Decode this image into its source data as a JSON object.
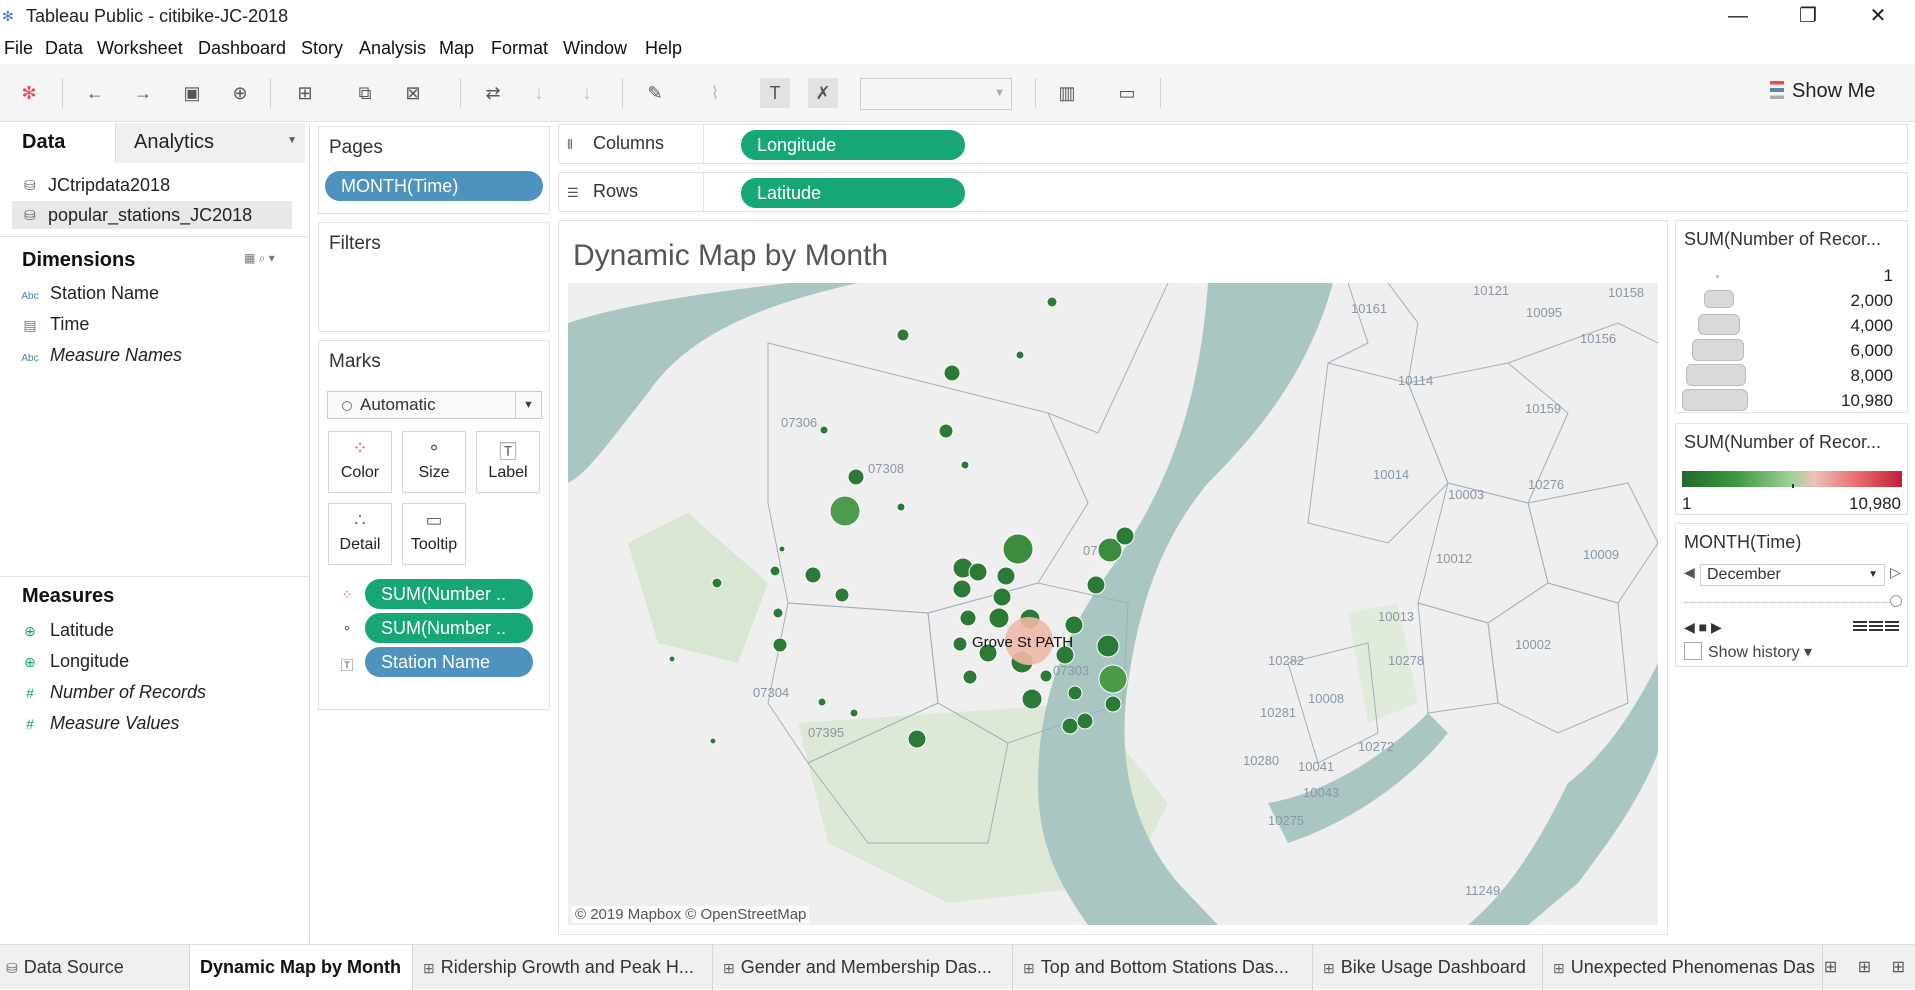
{
  "window": {
    "title": "Tableau Public - citibike-JC-2018",
    "minimize": "—",
    "restore": "❐",
    "close": "✕"
  },
  "menu": [
    "File",
    "Data",
    "Worksheet",
    "Dashboard",
    "Story",
    "Analysis",
    "Map",
    "Format",
    "Window",
    "Help"
  ],
  "toolbar": {
    "show_me": "Show Me"
  },
  "data_pane": {
    "tab_data": "Data",
    "tab_analytics": "Analytics",
    "datasources": [
      "JCtripdata2018",
      "popular_stations_JC2018"
    ],
    "dimensions_title": "Dimensions",
    "dimensions": [
      {
        "type": "Abc",
        "name": "Station Name"
      },
      {
        "type": "date",
        "name": "Time"
      },
      {
        "type": "Abc",
        "name": "Measure Names"
      }
    ],
    "measures_title": "Measures",
    "measures": [
      {
        "type": "geo",
        "name": "Latitude"
      },
      {
        "type": "geo",
        "name": "Longitude"
      },
      {
        "type": "num",
        "name": "Number of Records"
      },
      {
        "type": "num",
        "name": "Measure Values"
      }
    ]
  },
  "pages": {
    "title": "Pages",
    "pill": "MONTH(Time)"
  },
  "filters": {
    "title": "Filters"
  },
  "marks": {
    "title": "Marks",
    "mark_type": "Automatic",
    "buttons": [
      "Color",
      "Size",
      "Label",
      "Detail",
      "Tooltip"
    ],
    "pills": [
      "SUM(Number ..",
      "SUM(Number ..",
      "Station Name"
    ]
  },
  "shelves": {
    "columns_label": "Columns",
    "columns_pill": "Longitude",
    "rows_label": "Rows",
    "rows_pill": "Latitude"
  },
  "view": {
    "title": "Dynamic Map by Month",
    "highlight_label": "Grove St PATH",
    "credit": "© 2019 Mapbox © OpenStreetMap",
    "zip_labels": [
      "07306",
      "07308",
      "07304",
      "07395",
      "07303",
      "07",
      "10161",
      "10114",
      "10121",
      "10095",
      "10158",
      "10156",
      "10159",
      "10014",
      "10003",
      "10276",
      "10012",
      "10009",
      "10013",
      "10278",
      "10002",
      "10282",
      "10008",
      "10281",
      "10272",
      "10280",
      "10041",
      "10043",
      "10275",
      "11249"
    ]
  },
  "size_legend": {
    "title": "SUM(Number of Recor...",
    "values": [
      "1",
      "2,000",
      "4,000",
      "6,000",
      "8,000",
      "10,980"
    ]
  },
  "color_legend": {
    "title": "SUM(Number of Recor...",
    "min": "1",
    "max": "10,980"
  },
  "page_control": {
    "title": "MONTH(Time)",
    "selected": "December",
    "show_history": "Show history"
  },
  "bottom_tabs": [
    "Data Source",
    "Dynamic Map by Month",
    "Ridership Growth and Peak H...",
    "Gender and Membership Das...",
    "Top and Bottom Stations Das...",
    "Bike Usage Dashboard",
    "Unexpected Phenomenas Das"
  ],
  "colors": {
    "pill_green": "#17a776",
    "pill_blue": "#4d93bd",
    "water": "#a9c6c3",
    "mark_dark": "#1e6b2c"
  }
}
